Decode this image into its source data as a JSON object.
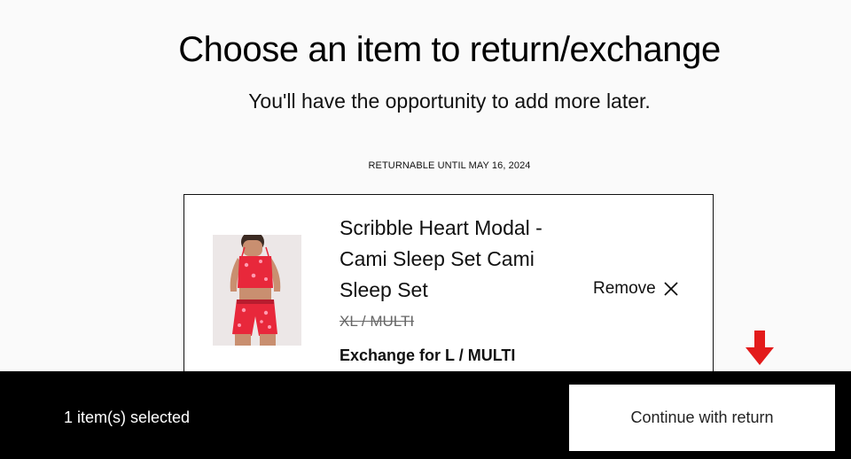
{
  "header": {
    "title": "Choose an item to return/exchange",
    "subtitle": "You'll have the opportunity to add more later."
  },
  "order": {
    "returnable_until": "RETURNABLE UNTIL MAY 16, 2024"
  },
  "item": {
    "name": "Scribble Heart Modal - Cami Sleep Set Cami Sleep Set",
    "original_variant": "XL / MULTI",
    "exchange_label": "Exchange for L / MULTI",
    "remove_label": "Remove"
  },
  "footer": {
    "selected_text": "1 item(s) selected",
    "continue_label": "Continue with return"
  },
  "colors": {
    "footer_bg": "#000000",
    "arrow": "#e31b1b",
    "product_red": "#e8283b"
  },
  "icons": {
    "remove": "close-icon",
    "pointer": "arrow-down-icon"
  }
}
